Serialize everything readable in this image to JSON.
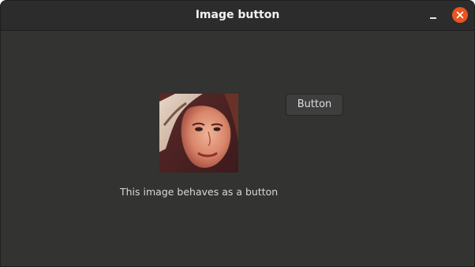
{
  "window": {
    "title": "Image button",
    "controls": {
      "minimize": "minimize-icon",
      "close": "close-icon"
    }
  },
  "main": {
    "image_button": {
      "icon": "portrait-photo"
    },
    "button_label": "Button",
    "caption": "This image behaves as a button"
  },
  "colors": {
    "window_bg": "#333331",
    "titlebar_bg": "#2c2c2c",
    "close_accent": "#e9541f",
    "text": "#d8d8d8"
  }
}
